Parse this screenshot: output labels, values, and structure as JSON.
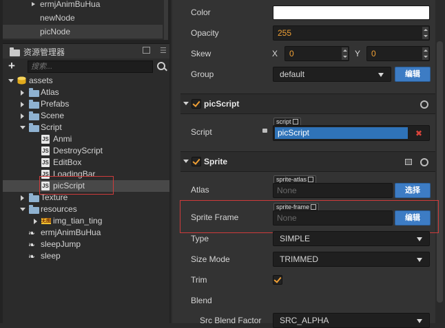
{
  "hierarchy": {
    "items": [
      {
        "label": "ermjAnimBuHua"
      },
      {
        "label": "newNode"
      },
      {
        "label": "picNode"
      }
    ]
  },
  "assets_panel": {
    "title": "资源管理器",
    "search_placeholder": "搜索..."
  },
  "tree": {
    "root": "assets",
    "items": [
      {
        "label": "Atlas"
      },
      {
        "label": "Prefabs"
      },
      {
        "label": "Scene"
      },
      {
        "label": "Script"
      },
      {
        "label": "Anmi"
      },
      {
        "label": "DestroyScript"
      },
      {
        "label": "EditBox"
      },
      {
        "label": "LoadingBar"
      },
      {
        "label": "picScript"
      },
      {
        "label": "Texture"
      },
      {
        "label": "resources"
      },
      {
        "label": "img_tian_ting"
      },
      {
        "label": "ermjAnimBuHua"
      },
      {
        "label": "sleepJump"
      },
      {
        "label": "sleep"
      }
    ],
    "js_badge": "JS",
    "img_badge": "无图"
  },
  "inspector": {
    "color_label": "Color",
    "opacity_label": "Opacity",
    "opacity_value": "255",
    "skew_label": "Skew",
    "skew_x_label": "X",
    "skew_x_value": "0",
    "skew_y_label": "Y",
    "skew_y_value": "0",
    "group_label": "Group",
    "group_value": "default",
    "edit_label": "编辑",
    "picscript": {
      "title": "picScript",
      "script_label": "Script",
      "script_tag": "script",
      "script_value": "picScript",
      "clear_icon": "✖"
    },
    "sprite": {
      "title": "Sprite",
      "atlas_label": "Atlas",
      "atlas_tag": "sprite-atlas",
      "atlas_value": "None",
      "select_label": "选择",
      "frame_label": "Sprite Frame",
      "frame_tag": "sprite-frame",
      "frame_value": "None",
      "frame_edit_label": "编辑",
      "type_label": "Type",
      "type_value": "SIMPLE",
      "size_mode_label": "Size Mode",
      "size_mode_value": "TRIMMED",
      "trim_label": "Trim",
      "blend_label": "Blend",
      "src_blend_label": "Src Blend Factor",
      "src_blend_value": "SRC_ALPHA"
    }
  },
  "colors": {
    "accent_orange": "#f0a035",
    "button_blue": "#3d7cc4",
    "highlight_red": "#d03b3b",
    "selection_blue": "#2f73b8"
  }
}
